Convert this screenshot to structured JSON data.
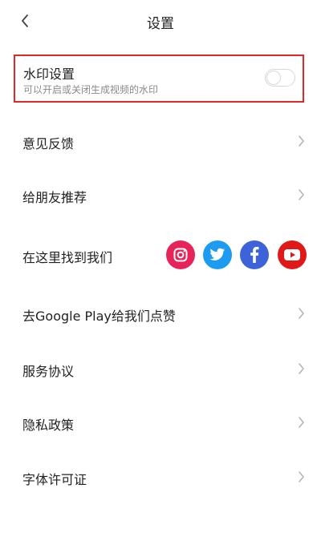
{
  "header": {
    "title": "设置"
  },
  "watermark": {
    "title": "水印设置",
    "subtitle": "可以开启或关闭生成视频的水印",
    "enabled": false,
    "highlight_color": "#e02828"
  },
  "menu": {
    "items": [
      {
        "label": "意见反馈"
      },
      {
        "label": "给朋友推荐"
      },
      {
        "label": "在这里找到我们"
      },
      {
        "label": "去Google Play给我们点赞"
      },
      {
        "label": "服务协议"
      },
      {
        "label": "隐私政策"
      },
      {
        "label": "字体许可证"
      }
    ]
  },
  "social": [
    {
      "name": "instagram-icon",
      "color": "#e6245a"
    },
    {
      "name": "twitter-icon",
      "color": "#1d9bf0"
    },
    {
      "name": "facebook-icon",
      "color": "#3d63d9"
    },
    {
      "name": "youtube-icon",
      "color": "#e01818"
    }
  ]
}
